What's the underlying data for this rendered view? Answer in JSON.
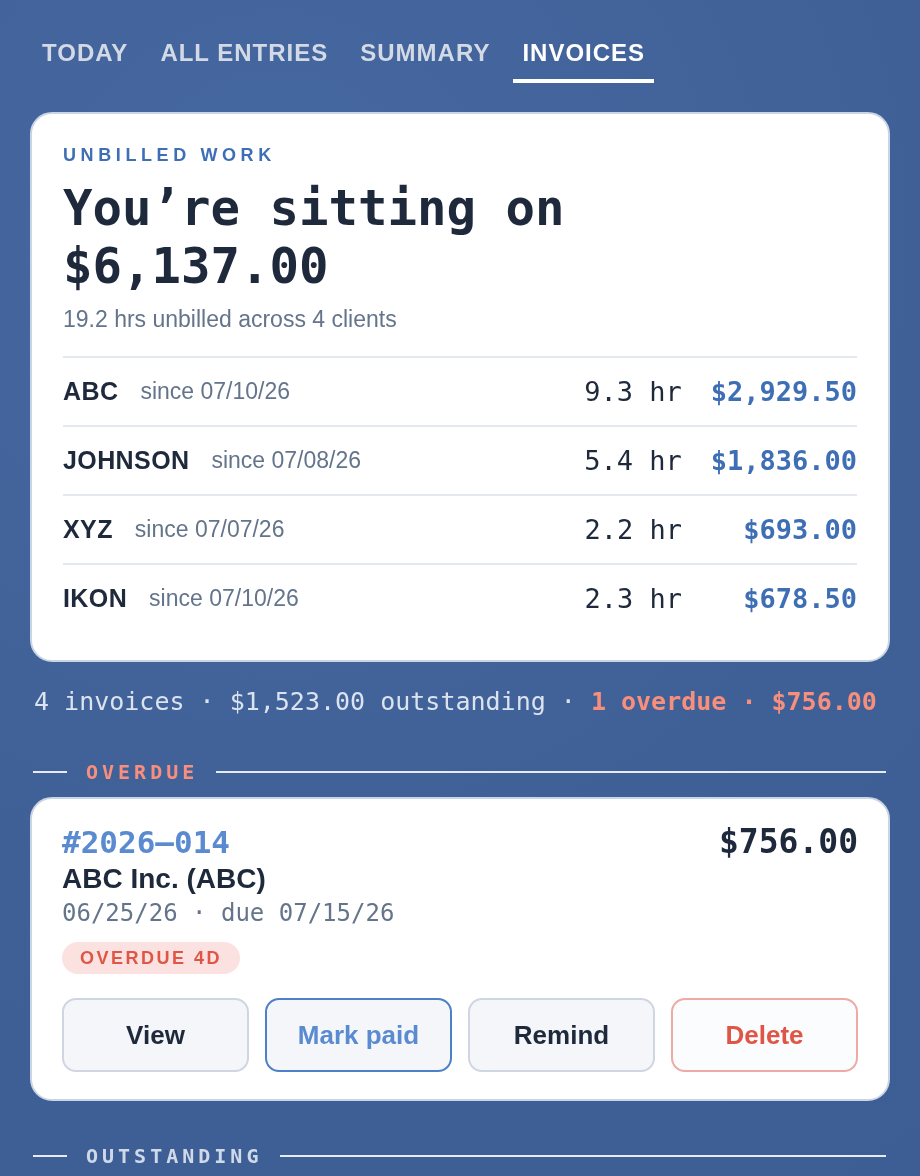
{
  "tabs": [
    {
      "label": "TODAY",
      "selected": false
    },
    {
      "label": "ALL ENTRIES",
      "selected": false
    },
    {
      "label": "SUMMARY",
      "selected": false
    },
    {
      "label": "INVOICES",
      "selected": true
    }
  ],
  "unbilled": {
    "eyebrow": "UNBILLED WORK",
    "headline": "You’re sitting on",
    "total": "$6,137.00",
    "subtitle": "19.2 hrs unbilled across 4 clients",
    "clients": [
      {
        "name": "ABC",
        "since": "since 07/10/26",
        "hours": "9.3 hr",
        "amount": "$2,929.50"
      },
      {
        "name": "JOHNSON",
        "since": "since 07/08/26",
        "hours": "5.4 hr",
        "amount": "$1,836.00"
      },
      {
        "name": "XYZ",
        "since": "since 07/07/26",
        "hours": "2.2 hr",
        "amount": "$693.00"
      },
      {
        "name": "IKON",
        "since": "since 07/10/26",
        "hours": "2.3 hr",
        "amount": "$678.50"
      }
    ]
  },
  "summary": "4 invoices · $1,523.00 outstanding · **1 overdue · $756.00**",
  "sections": [
    {
      "title": "OVERDUE",
      "kind": "overdue",
      "invoices": [
        {
          "number": "#2026–014",
          "amount": "$756.00",
          "client": "ABC Inc. (ABC)",
          "dates": "06/25/26 · due 07/15/26",
          "badge": "OVERDUE 4D",
          "actions": [
            {
              "label": "View",
              "kind": "default"
            },
            {
              "label": "Mark paid",
              "kind": "primary"
            },
            {
              "label": "Remind",
              "kind": "default"
            },
            {
              "label": "Delete",
              "kind": "danger"
            }
          ]
        }
      ]
    },
    {
      "title": "OUTSTANDING",
      "kind": "outstanding"
    }
  ]
}
